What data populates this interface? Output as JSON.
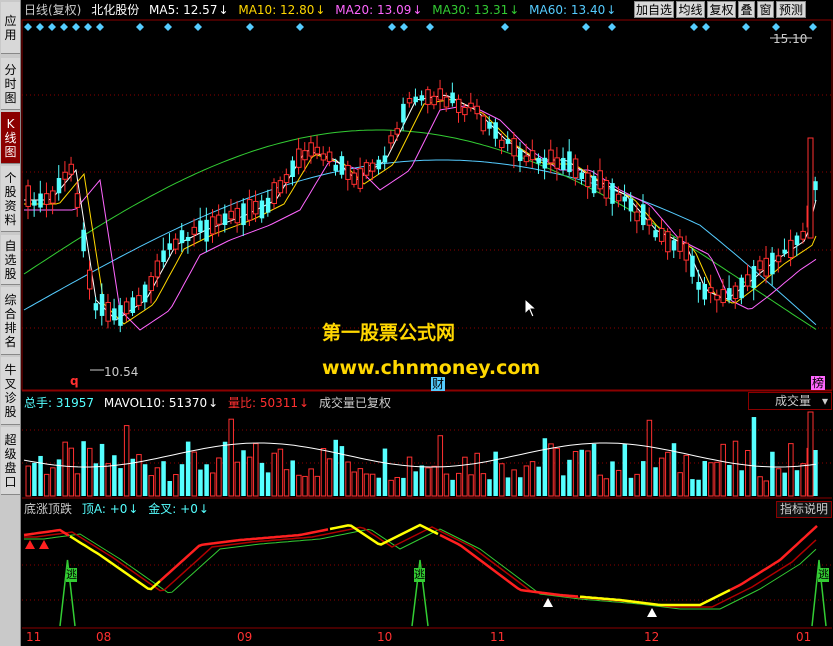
{
  "sidebar": {
    "tabs": [
      {
        "label": "应用",
        "active": false
      },
      {
        "label": "分时图",
        "active": false
      },
      {
        "label": "K线图",
        "active": true
      },
      {
        "label": "个股资料",
        "active": false
      },
      {
        "label": "自选股",
        "active": false
      },
      {
        "label": "综合排名",
        "active": false
      },
      {
        "label": "牛叉诊股",
        "active": false
      },
      {
        "label": "超级盘口",
        "active": false
      }
    ]
  },
  "price_header": {
    "period": "日线(复权)",
    "stock_name": "北化股份",
    "ma5": "MA5: 12.57",
    "ma10": "MA10: 12.80",
    "ma20": "MA20: 13.09",
    "ma30": "MA30: 13.31",
    "ma60": "MA60: 13.40",
    "arrow": "↓"
  },
  "toolbar": {
    "buttons": [
      "加自选",
      "均线",
      "复权",
      "叠",
      "窗",
      "预测"
    ]
  },
  "price_panel": {
    "high_label": "15.10",
    "low_label": "10.54",
    "marker_q": "q",
    "marker_cai": "财",
    "marker_bang": "榜"
  },
  "volume_header": {
    "total": "总手: 31957",
    "mavol": "MAVOL10: 51370",
    "ratio": "量比: 50311",
    "note": "成交量已复权",
    "arrow": "↓",
    "dropdown": "成交量"
  },
  "indicator_header": {
    "name": "底涨顶跌",
    "top_a": "顶A: +0",
    "golden": "金叉: +0",
    "arrow": "↓",
    "help_button": "指标说明",
    "escape_label": "逃"
  },
  "date_axis": [
    "11",
    "08",
    "09",
    "10",
    "11",
    "12",
    "01"
  ],
  "watermark": {
    "line1": "第一股票公式网",
    "line2": "www.chnmoney.com"
  },
  "colors": {
    "ma5": "#ffffff",
    "ma10": "#ffd700",
    "ma20": "#ff66ff",
    "ma30": "#33cc33",
    "ma60": "#55ccff",
    "up": "#ff3030",
    "down": "#55ffff"
  }
}
